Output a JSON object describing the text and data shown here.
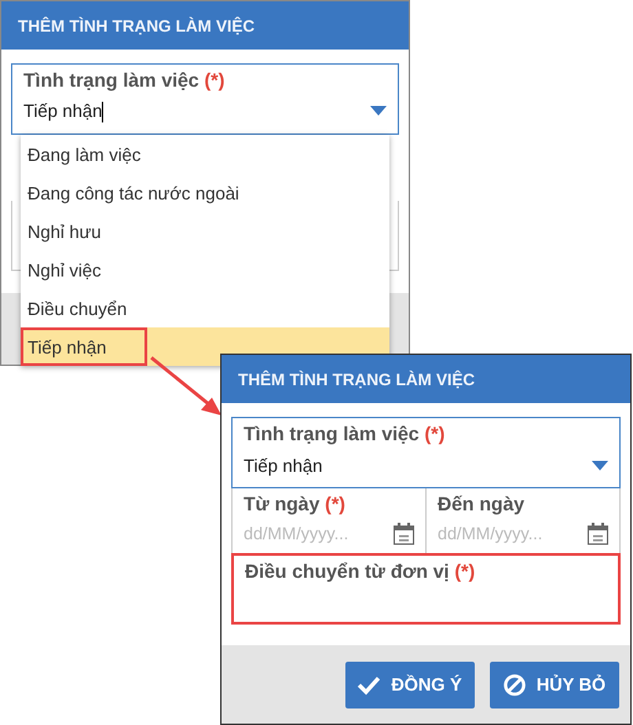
{
  "dialogs": [
    {
      "title": "THÊM TÌNH TRẠNG LÀM VIỆC",
      "status_field": {
        "label": "Tình trạng làm việc",
        "required_mark": "(*)",
        "value": "Tiếp nhận",
        "focused": true
      },
      "dropdown": {
        "options": [
          {
            "label": "Đang làm việc",
            "selected": false,
            "highlighted": false
          },
          {
            "label": "Đang công tác nước ngoài",
            "selected": false,
            "highlighted": false
          },
          {
            "label": "Nghỉ hưu",
            "selected": false,
            "highlighted": false
          },
          {
            "label": "Nghỉ việc",
            "selected": false,
            "highlighted": false
          },
          {
            "label": "Điều chuyển",
            "selected": false,
            "highlighted": false
          },
          {
            "label": "Tiếp nhận",
            "selected": true,
            "highlighted": true
          }
        ]
      }
    },
    {
      "title": "THÊM TÌNH TRẠNG LÀM VIỆC",
      "status_field": {
        "label": "Tình trạng làm việc",
        "required_mark": "(*)",
        "value": "Tiếp nhận",
        "focused": false
      },
      "from_date": {
        "label": "Từ ngày",
        "required_mark": "(*)",
        "placeholder": "dd/MM/yyyy..."
      },
      "to_date": {
        "label": "Đến ngày",
        "placeholder": "dd/MM/yyyy..."
      },
      "transfer_field": {
        "label": "Điều chuyển từ đơn vị",
        "required_mark": "(*)",
        "highlighted": true
      },
      "buttons": [
        {
          "label": "ĐỒNG Ý",
          "kind": "confirm"
        },
        {
          "label": "HỦY BỎ",
          "kind": "cancel"
        }
      ]
    }
  ]
}
